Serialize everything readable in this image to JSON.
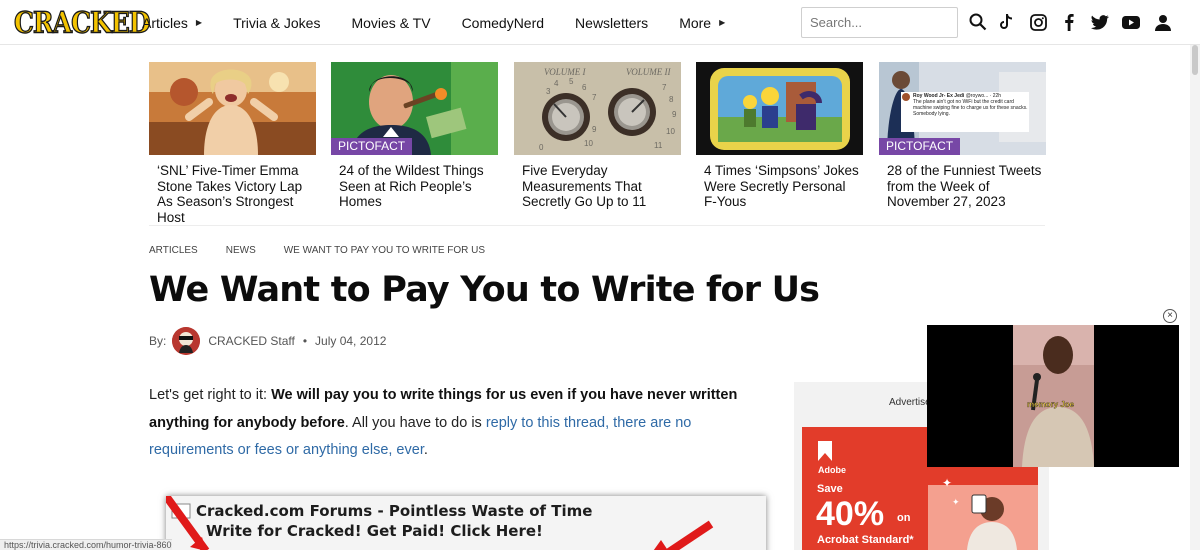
{
  "header": {
    "logo_text": "CRACKED",
    "nav": [
      {
        "label": "Articles",
        "has_caret": true
      },
      {
        "label": "Trivia & Jokes",
        "has_caret": false
      },
      {
        "label": "Movies & TV",
        "has_caret": false
      },
      {
        "label": "ComedyNerd",
        "has_caret": false
      },
      {
        "label": "Newsletters",
        "has_caret": false
      },
      {
        "label": "More",
        "has_caret": true
      }
    ],
    "search_placeholder": "Search...",
    "icons": [
      "search-icon",
      "tiktok-icon",
      "instagram-icon",
      "facebook-icon",
      "twitter-icon",
      "youtube-icon",
      "user-icon"
    ]
  },
  "cards": [
    {
      "title": "‘SNL’ Five-Timer Emma Stone Takes Victory Lap As Season’s Strongest Host",
      "badge": ""
    },
    {
      "title": "24 of the Wildest Things Seen at Rich People’s Homes",
      "badge": "PICTOFACT"
    },
    {
      "title": "Five Everyday Measurements That Secretly Go Up to 11",
      "badge": "",
      "image_text": {
        "left_label": "VOLUME I",
        "right_label": "VOLUME II",
        "left_digits": [
          "3",
          "4",
          "5",
          "6",
          "7",
          "0",
          "9",
          "10"
        ],
        "right_digits": [
          "7",
          "8",
          "9",
          "10",
          "11"
        ]
      }
    },
    {
      "title": "4 Times ‘Simpsons’ Jokes Were Secretly Personal F-Yous",
      "badge": ""
    },
    {
      "title": "28 of the Funniest Tweets from the Week of November 27, 2023",
      "badge": "PICTOFACT",
      "image_text": {
        "tweet_author": "Roy Wood Jr- Ex Jedi",
        "tweet_handle": "@roywo... · 22h",
        "tweet_body": "The plane ain’t got no WiFi but the credit card machine swiping fine to charge us for these snacks. Somebody lying."
      }
    }
  ],
  "breadcrumbs": [
    "ARTICLES",
    "NEWS",
    "WE WANT TO PAY YOU TO WRITE FOR US"
  ],
  "article": {
    "headline": "We Want to Pay You to Write for Us",
    "by_label": "By:",
    "author": "CRACKED Staff",
    "date": "July 04, 2012",
    "intro_plain": "Let's get right to it: ",
    "intro_bold": "We will pay you to write things for us even if you have never written anything for anybody before",
    "intro_plain2": ". All you have to do is ",
    "intro_link": "reply to this thread, there are no requirements or fees or anything else, ever",
    "intro_end": "."
  },
  "forum_image": {
    "line1": "Cracked.com Forums - Pointless Waste of Time",
    "line2": "Write for Cracked! Get Paid! Click Here!"
  },
  "status_url": "https://trivia.cracked.com/humor-trivia-8602",
  "ad": {
    "label": "Advertisement",
    "brand": "Adobe",
    "save": "Save",
    "percent": "40%",
    "on": "on",
    "product": "Acrobat Standard*"
  },
  "video": {
    "caption": "memory Joe",
    "close_label": "×"
  },
  "colors": {
    "accent_purple": "#7747a6",
    "link_blue": "#2f6aa6",
    "logo_yellow": "#f3c300",
    "ad_red": "#e23c2a"
  }
}
